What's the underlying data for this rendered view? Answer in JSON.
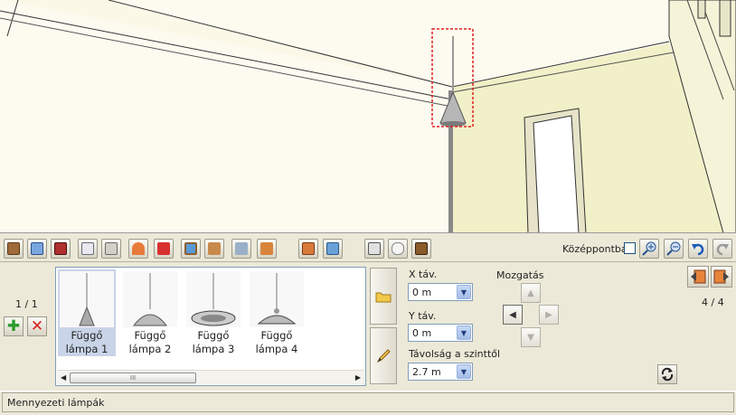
{
  "viewport": {
    "label": "3D room view"
  },
  "toolbar": {
    "tool_icons": [
      "door-icon",
      "window-icon",
      "fireplace-icon",
      "cabinet-icon",
      "radiator-icon",
      "ceiling-lamp-icon",
      "wall-lamp-icon",
      "picture-icon",
      "floor-icon-1",
      "floor-icon-2",
      "floor-icon-3",
      "kitchen-icon-1",
      "kitchen-icon-2",
      "appliance-icon",
      "toilet-icon",
      "wardrobe-icon"
    ],
    "center_label": "Középpontba",
    "zoom_in_icon": "zoom-in-icon",
    "zoom_out_icon": "zoom-out-icon",
    "undo_icon": "undo-icon",
    "redo_icon": "redo-icon"
  },
  "panel": {
    "counter_left": "1 / 1",
    "counter_right": "4 / 4",
    "library": {
      "items": [
        {
          "line1": "Függő",
          "line2": "lámpa 1",
          "selected": true
        },
        {
          "line1": "Függő",
          "line2": "lámpa 2",
          "selected": false
        },
        {
          "line1": "Függő",
          "line2": "lámpa 3",
          "selected": false
        },
        {
          "line1": "Függő",
          "line2": "lámpa 4",
          "selected": false
        }
      ],
      "scroll_grip": "III"
    },
    "x_label": "X táv.",
    "x_value": "0 m",
    "y_label": "Y táv.",
    "y_value": "0 m",
    "dist_label": "Távolság a szinttől",
    "dist_value": "2.7 m",
    "move_label": "Mozgatás"
  },
  "status": {
    "text": "Mennyezeti lámpák"
  },
  "colors": {
    "accent_red": "#e02020",
    "selection": "#c9d4e8",
    "wall": "#fdfbf0"
  }
}
